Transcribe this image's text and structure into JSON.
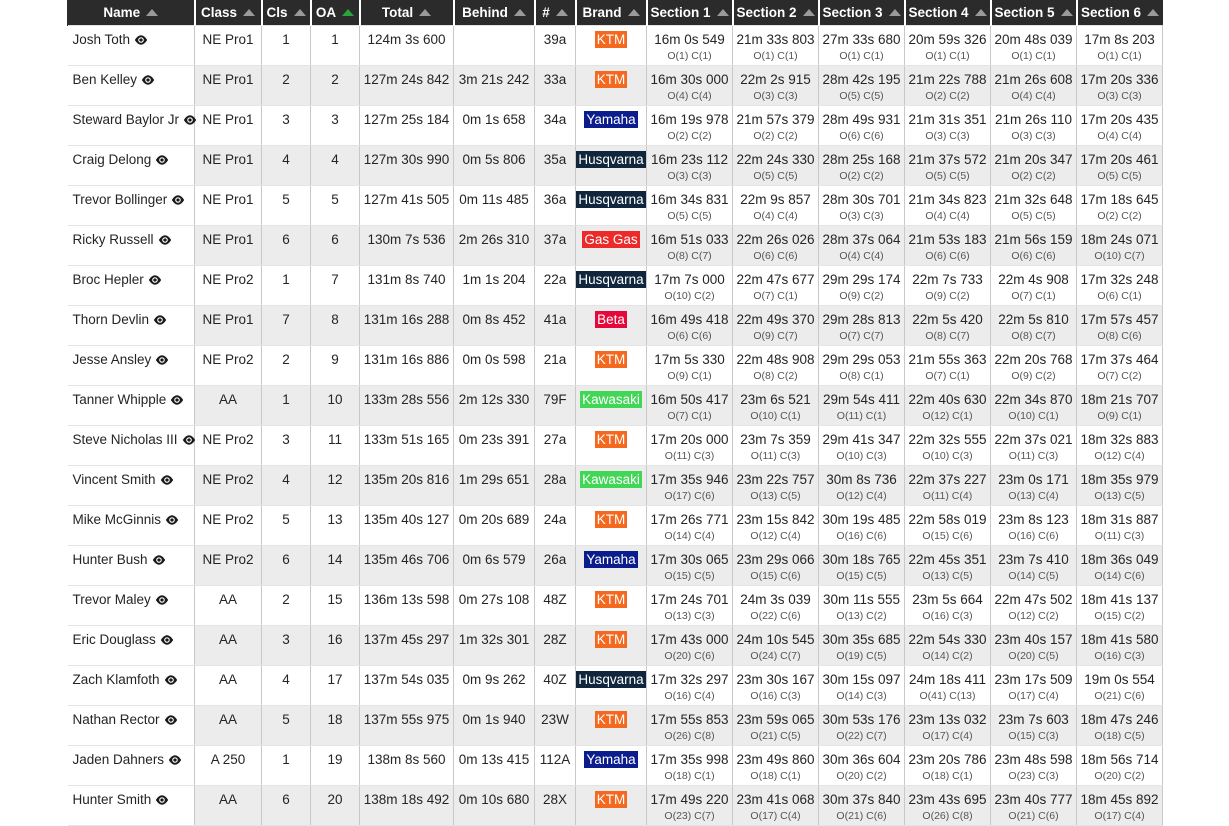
{
  "table": {
    "columns": [
      {
        "key": "name",
        "label": "Name",
        "sorted": false
      },
      {
        "key": "class",
        "label": "Class",
        "sorted": false
      },
      {
        "key": "cls",
        "label": "Cls",
        "sorted": false
      },
      {
        "key": "oa",
        "label": "OA",
        "sorted": true
      },
      {
        "key": "total",
        "label": "Total",
        "sorted": false
      },
      {
        "key": "behind",
        "label": "Behind",
        "sorted": false
      },
      {
        "key": "num",
        "label": "#",
        "sorted": false
      },
      {
        "key": "brand",
        "label": "Brand",
        "sorted": false
      },
      {
        "key": "sec1",
        "label": "Section 1",
        "sorted": false
      },
      {
        "key": "sec2",
        "label": "Section 2",
        "sorted": false
      },
      {
        "key": "sec3",
        "label": "Section 3",
        "sorted": false
      },
      {
        "key": "sec4",
        "label": "Section 4",
        "sorted": false
      },
      {
        "key": "sec5",
        "label": "Section 5",
        "sorted": false
      },
      {
        "key": "sec6",
        "label": "Section 6",
        "sorted": false
      }
    ],
    "brand_colors": {
      "KTM": "#f4681f",
      "Yamaha": "#0b1d8c",
      "Husqvarna": "#10263d",
      "Gas Gas": "#ed2a2a",
      "Beta": "#e5083a",
      "Kawasaki": "#42d656"
    },
    "icons": {
      "row_view": "eye-icon",
      "sort": "sort-ascending-arrow"
    },
    "rows": [
      {
        "name": "Josh Toth",
        "class": "NE Pro1",
        "cls": "1",
        "oa": "1",
        "total": "124m 3s 600",
        "behind": "",
        "num": "39a",
        "brand": "KTM",
        "sections": [
          {
            "time": "16m 0s 549",
            "pos": "O(1) C(1)"
          },
          {
            "time": "21m 33s 803",
            "pos": "O(1) C(1)"
          },
          {
            "time": "27m 33s 680",
            "pos": "O(1) C(1)"
          },
          {
            "time": "20m 59s 326",
            "pos": "O(1) C(1)"
          },
          {
            "time": "20m 48s 039",
            "pos": "O(1) C(1)"
          },
          {
            "time": "17m 8s 203",
            "pos": "O(1) C(1)"
          }
        ]
      },
      {
        "name": "Ben Kelley",
        "class": "NE Pro1",
        "cls": "2",
        "oa": "2",
        "total": "127m 24s 842",
        "behind": "3m 21s 242",
        "num": "33a",
        "brand": "KTM",
        "sections": [
          {
            "time": "16m 30s 000",
            "pos": "O(4) C(4)"
          },
          {
            "time": "22m 2s 915",
            "pos": "O(3) C(3)"
          },
          {
            "time": "28m 42s 195",
            "pos": "O(5) C(5)"
          },
          {
            "time": "21m 22s 788",
            "pos": "O(2) C(2)"
          },
          {
            "time": "21m 26s 608",
            "pos": "O(4) C(4)"
          },
          {
            "time": "17m 20s 336",
            "pos": "O(3) C(3)"
          }
        ]
      },
      {
        "name": "Steward Baylor Jr",
        "class": "NE Pro1",
        "cls": "3",
        "oa": "3",
        "total": "127m 25s 184",
        "behind": "0m 1s 658",
        "num": "34a",
        "brand": "Yamaha",
        "sections": [
          {
            "time": "16m 19s 978",
            "pos": "O(2) C(2)"
          },
          {
            "time": "21m 57s 379",
            "pos": "O(2) C(2)"
          },
          {
            "time": "28m 49s 931",
            "pos": "O(6) C(6)"
          },
          {
            "time": "21m 31s 351",
            "pos": "O(3) C(3)"
          },
          {
            "time": "21m 26s 110",
            "pos": "O(3) C(3)"
          },
          {
            "time": "17m 20s 435",
            "pos": "O(4) C(4)"
          }
        ]
      },
      {
        "name": "Craig Delong",
        "class": "NE Pro1",
        "cls": "4",
        "oa": "4",
        "total": "127m 30s 990",
        "behind": "0m 5s 806",
        "num": "35a",
        "brand": "Husqvarna",
        "sections": [
          {
            "time": "16m 23s 112",
            "pos": "O(3) C(3)"
          },
          {
            "time": "22m 24s 330",
            "pos": "O(5) C(5)"
          },
          {
            "time": "28m 25s 168",
            "pos": "O(2) C(2)"
          },
          {
            "time": "21m 37s 572",
            "pos": "O(5) C(5)"
          },
          {
            "time": "21m 20s 347",
            "pos": "O(2) C(2)"
          },
          {
            "time": "17m 20s 461",
            "pos": "O(5) C(5)"
          }
        ]
      },
      {
        "name": "Trevor Bollinger",
        "class": "NE Pro1",
        "cls": "5",
        "oa": "5",
        "total": "127m 41s 505",
        "behind": "0m 11s 485",
        "num": "36a",
        "brand": "Husqvarna",
        "sections": [
          {
            "time": "16m 34s 831",
            "pos": "O(5) C(5)"
          },
          {
            "time": "22m 9s 857",
            "pos": "O(4) C(4)"
          },
          {
            "time": "28m 30s 701",
            "pos": "O(3) C(3)"
          },
          {
            "time": "21m 34s 823",
            "pos": "O(4) C(4)"
          },
          {
            "time": "21m 32s 648",
            "pos": "O(5) C(5)"
          },
          {
            "time": "17m 18s 645",
            "pos": "O(2) C(2)"
          }
        ]
      },
      {
        "name": "Ricky Russell",
        "class": "NE Pro1",
        "cls": "6",
        "oa": "6",
        "total": "130m 7s 536",
        "behind": "2m 26s 310",
        "num": "37a",
        "brand": "Gas Gas",
        "sections": [
          {
            "time": "16m 51s 033",
            "pos": "O(8) C(7)"
          },
          {
            "time": "22m 26s 026",
            "pos": "O(6) C(6)"
          },
          {
            "time": "28m 37s 064",
            "pos": "O(4) C(4)"
          },
          {
            "time": "21m 53s 183",
            "pos": "O(6) C(6)"
          },
          {
            "time": "21m 56s 159",
            "pos": "O(6) C(6)"
          },
          {
            "time": "18m 24s 071",
            "pos": "O(10) C(7)"
          }
        ]
      },
      {
        "name": "Broc Hepler",
        "class": "NE Pro2",
        "cls": "1",
        "oa": "7",
        "total": "131m 8s 740",
        "behind": "1m 1s 204",
        "num": "22a",
        "brand": "Husqvarna",
        "sections": [
          {
            "time": "17m 7s 000",
            "pos": "O(10) C(2)"
          },
          {
            "time": "22m 47s 677",
            "pos": "O(7) C(1)"
          },
          {
            "time": "29m 29s 174",
            "pos": "O(9) C(2)"
          },
          {
            "time": "22m 7s 733",
            "pos": "O(9) C(2)"
          },
          {
            "time": "22m 4s 908",
            "pos": "O(7) C(1)"
          },
          {
            "time": "17m 32s 248",
            "pos": "O(6) C(1)"
          }
        ]
      },
      {
        "name": "Thorn Devlin",
        "class": "NE Pro1",
        "cls": "7",
        "oa": "8",
        "total": "131m 16s 288",
        "behind": "0m 8s 452",
        "num": "41a",
        "brand": "Beta",
        "sections": [
          {
            "time": "16m 49s 418",
            "pos": "O(6) C(6)"
          },
          {
            "time": "22m 49s 370",
            "pos": "O(9) C(7)"
          },
          {
            "time": "29m 28s 813",
            "pos": "O(7) C(7)"
          },
          {
            "time": "22m 5s 420",
            "pos": "O(8) C(7)"
          },
          {
            "time": "22m 5s 810",
            "pos": "O(8) C(7)"
          },
          {
            "time": "17m 57s 457",
            "pos": "O(8) C(6)"
          }
        ]
      },
      {
        "name": "Jesse Ansley",
        "class": "NE Pro2",
        "cls": "2",
        "oa": "9",
        "total": "131m 16s 886",
        "behind": "0m 0s 598",
        "num": "21a",
        "brand": "KTM",
        "sections": [
          {
            "time": "17m 5s 330",
            "pos": "O(9) C(1)"
          },
          {
            "time": "22m 48s 908",
            "pos": "O(8) C(2)"
          },
          {
            "time": "29m 29s 053",
            "pos": "O(8) C(1)"
          },
          {
            "time": "21m 55s 363",
            "pos": "O(7) C(1)"
          },
          {
            "time": "22m 20s 768",
            "pos": "O(9) C(2)"
          },
          {
            "time": "17m 37s 464",
            "pos": "O(7) C(2)"
          }
        ]
      },
      {
        "name": "Tanner Whipple",
        "class": "AA",
        "cls": "1",
        "oa": "10",
        "total": "133m 28s 556",
        "behind": "2m 12s 330",
        "num": "79F",
        "brand": "Kawasaki",
        "sections": [
          {
            "time": "16m 50s 417",
            "pos": "O(7) C(1)"
          },
          {
            "time": "23m 6s 521",
            "pos": "O(10) C(1)"
          },
          {
            "time": "29m 54s 411",
            "pos": "O(11) C(1)"
          },
          {
            "time": "22m 40s 630",
            "pos": "O(12) C(1)"
          },
          {
            "time": "22m 34s 870",
            "pos": "O(10) C(1)"
          },
          {
            "time": "18m 21s 707",
            "pos": "O(9) C(1)"
          }
        ]
      },
      {
        "name": "Steve Nicholas III",
        "class": "NE Pro2",
        "cls": "3",
        "oa": "11",
        "total": "133m 51s 165",
        "behind": "0m 23s 391",
        "num": "27a",
        "brand": "KTM",
        "sections": [
          {
            "time": "17m 20s 000",
            "pos": "O(11) C(3)"
          },
          {
            "time": "23m 7s 359",
            "pos": "O(11) C(3)"
          },
          {
            "time": "29m 41s 347",
            "pos": "O(10) C(3)"
          },
          {
            "time": "22m 32s 555",
            "pos": "O(10) C(3)"
          },
          {
            "time": "22m 37s 021",
            "pos": "O(11) C(3)"
          },
          {
            "time": "18m 32s 883",
            "pos": "O(12) C(4)"
          }
        ]
      },
      {
        "name": "Vincent Smith",
        "class": "NE Pro2",
        "cls": "4",
        "oa": "12",
        "total": "135m 20s 816",
        "behind": "1m 29s 651",
        "num": "28a",
        "brand": "Kawasaki",
        "sections": [
          {
            "time": "17m 35s 946",
            "pos": "O(17) C(6)"
          },
          {
            "time": "23m 22s 757",
            "pos": "O(13) C(5)"
          },
          {
            "time": "30m 8s 736",
            "pos": "O(12) C(4)"
          },
          {
            "time": "22m 37s 227",
            "pos": "O(11) C(4)"
          },
          {
            "time": "23m 0s 171",
            "pos": "O(13) C(4)"
          },
          {
            "time": "18m 35s 979",
            "pos": "O(13) C(5)"
          }
        ]
      },
      {
        "name": "Mike McGinnis",
        "class": "NE Pro2",
        "cls": "5",
        "oa": "13",
        "total": "135m 40s 127",
        "behind": "0m 20s 689",
        "num": "24a",
        "brand": "KTM",
        "sections": [
          {
            "time": "17m 26s 771",
            "pos": "O(14) C(4)"
          },
          {
            "time": "23m 15s 842",
            "pos": "O(12) C(4)"
          },
          {
            "time": "30m 19s 485",
            "pos": "O(16) C(6)"
          },
          {
            "time": "22m 58s 019",
            "pos": "O(15) C(6)"
          },
          {
            "time": "23m 8s 123",
            "pos": "O(16) C(6)"
          },
          {
            "time": "18m 31s 887",
            "pos": "O(11) C(3)"
          }
        ]
      },
      {
        "name": "Hunter Bush",
        "class": "NE Pro2",
        "cls": "6",
        "oa": "14",
        "total": "135m 46s 706",
        "behind": "0m 6s 579",
        "num": "26a",
        "brand": "Yamaha",
        "sections": [
          {
            "time": "17m 30s 065",
            "pos": "O(15) C(5)"
          },
          {
            "time": "23m 29s 066",
            "pos": "O(15) C(6)"
          },
          {
            "time": "30m 18s 765",
            "pos": "O(15) C(5)"
          },
          {
            "time": "22m 45s 351",
            "pos": "O(13) C(5)"
          },
          {
            "time": "23m 7s 410",
            "pos": "O(14) C(5)"
          },
          {
            "time": "18m 36s 049",
            "pos": "O(14) C(6)"
          }
        ]
      },
      {
        "name": "Trevor Maley",
        "class": "AA",
        "cls": "2",
        "oa": "15",
        "total": "136m 13s 598",
        "behind": "0m 27s 108",
        "num": "48Z",
        "brand": "KTM",
        "sections": [
          {
            "time": "17m 24s 701",
            "pos": "O(13) C(3)"
          },
          {
            "time": "24m 3s 039",
            "pos": "O(22) C(6)"
          },
          {
            "time": "30m 11s 555",
            "pos": "O(13) C(2)"
          },
          {
            "time": "23m 5s 664",
            "pos": "O(16) C(3)"
          },
          {
            "time": "22m 47s 502",
            "pos": "O(12) C(2)"
          },
          {
            "time": "18m 41s 137",
            "pos": "O(15) C(2)"
          }
        ]
      },
      {
        "name": "Eric Douglass",
        "class": "AA",
        "cls": "3",
        "oa": "16",
        "total": "137m 45s 297",
        "behind": "1m 32s 301",
        "num": "28Z",
        "brand": "KTM",
        "sections": [
          {
            "time": "17m 43s 000",
            "pos": "O(20) C(6)"
          },
          {
            "time": "24m 10s 545",
            "pos": "O(24) C(7)"
          },
          {
            "time": "30m 35s 685",
            "pos": "O(19) C(5)"
          },
          {
            "time": "22m 54s 330",
            "pos": "O(14) C(2)"
          },
          {
            "time": "23m 40s 157",
            "pos": "O(20) C(5)"
          },
          {
            "time": "18m 41s 580",
            "pos": "O(16) C(3)"
          }
        ]
      },
      {
        "name": "Zach Klamfoth",
        "class": "AA",
        "cls": "4",
        "oa": "17",
        "total": "137m 54s 035",
        "behind": "0m 9s 262",
        "num": "40Z",
        "brand": "Husqvarna",
        "sections": [
          {
            "time": "17m 32s 297",
            "pos": "O(16) C(4)"
          },
          {
            "time": "23m 30s 167",
            "pos": "O(16) C(3)"
          },
          {
            "time": "30m 15s 097",
            "pos": "O(14) C(3)"
          },
          {
            "time": "24m 18s 411",
            "pos": "O(41) C(13)"
          },
          {
            "time": "23m 17s 509",
            "pos": "O(17) C(4)"
          },
          {
            "time": "19m 0s 554",
            "pos": "O(21) C(6)"
          }
        ]
      },
      {
        "name": "Nathan Rector",
        "class": "AA",
        "cls": "5",
        "oa": "18",
        "total": "137m 55s 975",
        "behind": "0m 1s 940",
        "num": "23W",
        "brand": "KTM",
        "sections": [
          {
            "time": "17m 55s 853",
            "pos": "O(26) C(8)"
          },
          {
            "time": "23m 59s 065",
            "pos": "O(21) C(5)"
          },
          {
            "time": "30m 53s 176",
            "pos": "O(22) C(7)"
          },
          {
            "time": "23m 13s 032",
            "pos": "O(17) C(4)"
          },
          {
            "time": "23m 7s 603",
            "pos": "O(15) C(3)"
          },
          {
            "time": "18m 47s 246",
            "pos": "O(18) C(5)"
          }
        ]
      },
      {
        "name": "Jaden Dahners",
        "class": "A 250",
        "cls": "1",
        "oa": "19",
        "total": "138m 8s 560",
        "behind": "0m 13s 415",
        "num": "112A",
        "brand": "Yamaha",
        "sections": [
          {
            "time": "17m 35s 998",
            "pos": "O(18) C(1)"
          },
          {
            "time": "23m 49s 860",
            "pos": "O(18) C(1)"
          },
          {
            "time": "30m 36s 604",
            "pos": "O(20) C(2)"
          },
          {
            "time": "23m 20s 786",
            "pos": "O(18) C(1)"
          },
          {
            "time": "23m 48s 598",
            "pos": "O(23) C(3)"
          },
          {
            "time": "18m 56s 714",
            "pos": "O(20) C(2)"
          }
        ]
      },
      {
        "name": "Hunter Smith",
        "class": "AA",
        "cls": "6",
        "oa": "20",
        "total": "138m 18s 492",
        "behind": "0m 10s 680",
        "num": "28X",
        "brand": "KTM",
        "sections": [
          {
            "time": "17m 49s 220",
            "pos": "O(23) C(7)"
          },
          {
            "time": "23m 41s 068",
            "pos": "O(17) C(4)"
          },
          {
            "time": "30m 37s 840",
            "pos": "O(21) C(6)"
          },
          {
            "time": "23m 43s 695",
            "pos": "O(26) C(8)"
          },
          {
            "time": "23m 40s 777",
            "pos": "O(21) C(6)"
          },
          {
            "time": "18m 45s 892",
            "pos": "O(17) C(4)"
          }
        ]
      }
    ]
  }
}
